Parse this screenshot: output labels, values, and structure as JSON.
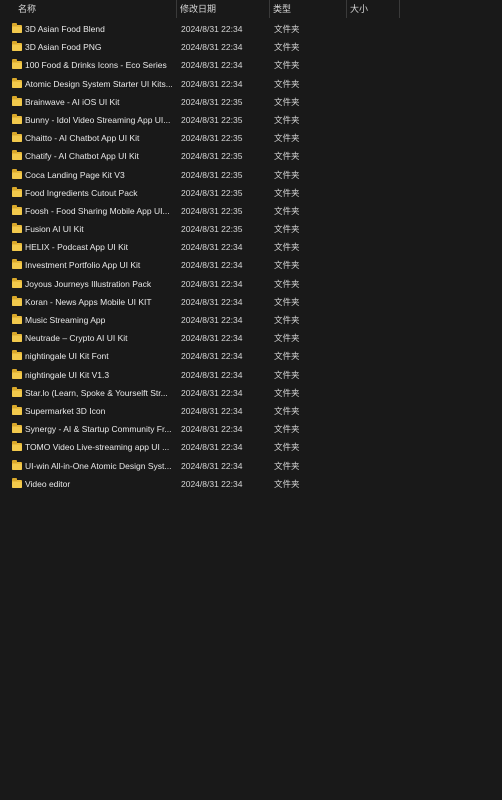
{
  "columns": {
    "name": "名称",
    "modified": "修改日期",
    "type": "类型",
    "size": "大小"
  },
  "files": [
    {
      "name": "3D Asian Food Blend",
      "modified": "2024/8/31 22:34",
      "type": "文件夹"
    },
    {
      "name": "3D Asian Food PNG",
      "modified": "2024/8/31 22:34",
      "type": "文件夹"
    },
    {
      "name": "100 Food & Drinks Icons - Eco Series",
      "modified": "2024/8/31 22:34",
      "type": "文件夹"
    },
    {
      "name": "Atomic Design System Starter UI Kits...",
      "modified": "2024/8/31 22:34",
      "type": "文件夹"
    },
    {
      "name": "Brainwave - AI iOS UI Kit",
      "modified": "2024/8/31 22:35",
      "type": "文件夹"
    },
    {
      "name": "Bunny - Idol Video Streaming App UI...",
      "modified": "2024/8/31 22:35",
      "type": "文件夹"
    },
    {
      "name": "Chaitto - AI Chatbot App UI Kit",
      "modified": "2024/8/31 22:35",
      "type": "文件夹"
    },
    {
      "name": "Chatify - AI Chatbot App UI Kit",
      "modified": "2024/8/31 22:35",
      "type": "文件夹"
    },
    {
      "name": "Coca Landing Page Kit V3",
      "modified": "2024/8/31 22:35",
      "type": "文件夹"
    },
    {
      "name": "Food Ingredients Cutout Pack",
      "modified": "2024/8/31 22:35",
      "type": "文件夹"
    },
    {
      "name": "Foosh - Food Sharing Mobile App UI...",
      "modified": "2024/8/31 22:35",
      "type": "文件夹"
    },
    {
      "name": "Fusion AI UI Kit",
      "modified": "2024/8/31 22:35",
      "type": "文件夹"
    },
    {
      "name": "HELIX - Podcast App UI Kit",
      "modified": "2024/8/31 22:34",
      "type": "文件夹"
    },
    {
      "name": "Investment Portfolio App UI Kit",
      "modified": "2024/8/31 22:34",
      "type": "文件夹"
    },
    {
      "name": "Joyous Journeys Illustration Pack",
      "modified": "2024/8/31 22:34",
      "type": "文件夹"
    },
    {
      "name": "Koran - News Apps Mobile UI KIT",
      "modified": "2024/8/31 22:34",
      "type": "文件夹"
    },
    {
      "name": "Music Streaming App",
      "modified": "2024/8/31 22:34",
      "type": "文件夹"
    },
    {
      "name": "Neutrade – Crypto AI UI Kit",
      "modified": "2024/8/31 22:34",
      "type": "文件夹"
    },
    {
      "name": "nightingale UI Kit Font",
      "modified": "2024/8/31 22:34",
      "type": "文件夹"
    },
    {
      "name": "nightingale UI Kit V1.3",
      "modified": "2024/8/31 22:34",
      "type": "文件夹"
    },
    {
      "name": "Star.lo (Learn, Spoke & Yourselft Str...",
      "modified": "2024/8/31 22:34",
      "type": "文件夹"
    },
    {
      "name": "Supermarket 3D Icon",
      "modified": "2024/8/31 22:34",
      "type": "文件夹"
    },
    {
      "name": "Synergy - AI & Startup Community Fr...",
      "modified": "2024/8/31 22:34",
      "type": "文件夹"
    },
    {
      "name": "TOMO Video Live-streaming app UI ...",
      "modified": "2024/8/31 22:34",
      "type": "文件夹"
    },
    {
      "name": "UI-win All-in-One Atomic Design Syst...",
      "modified": "2024/8/31 22:34",
      "type": "文件夹"
    },
    {
      "name": "Video editor",
      "modified": "2024/8/31 22:34",
      "type": "文件夹"
    }
  ]
}
